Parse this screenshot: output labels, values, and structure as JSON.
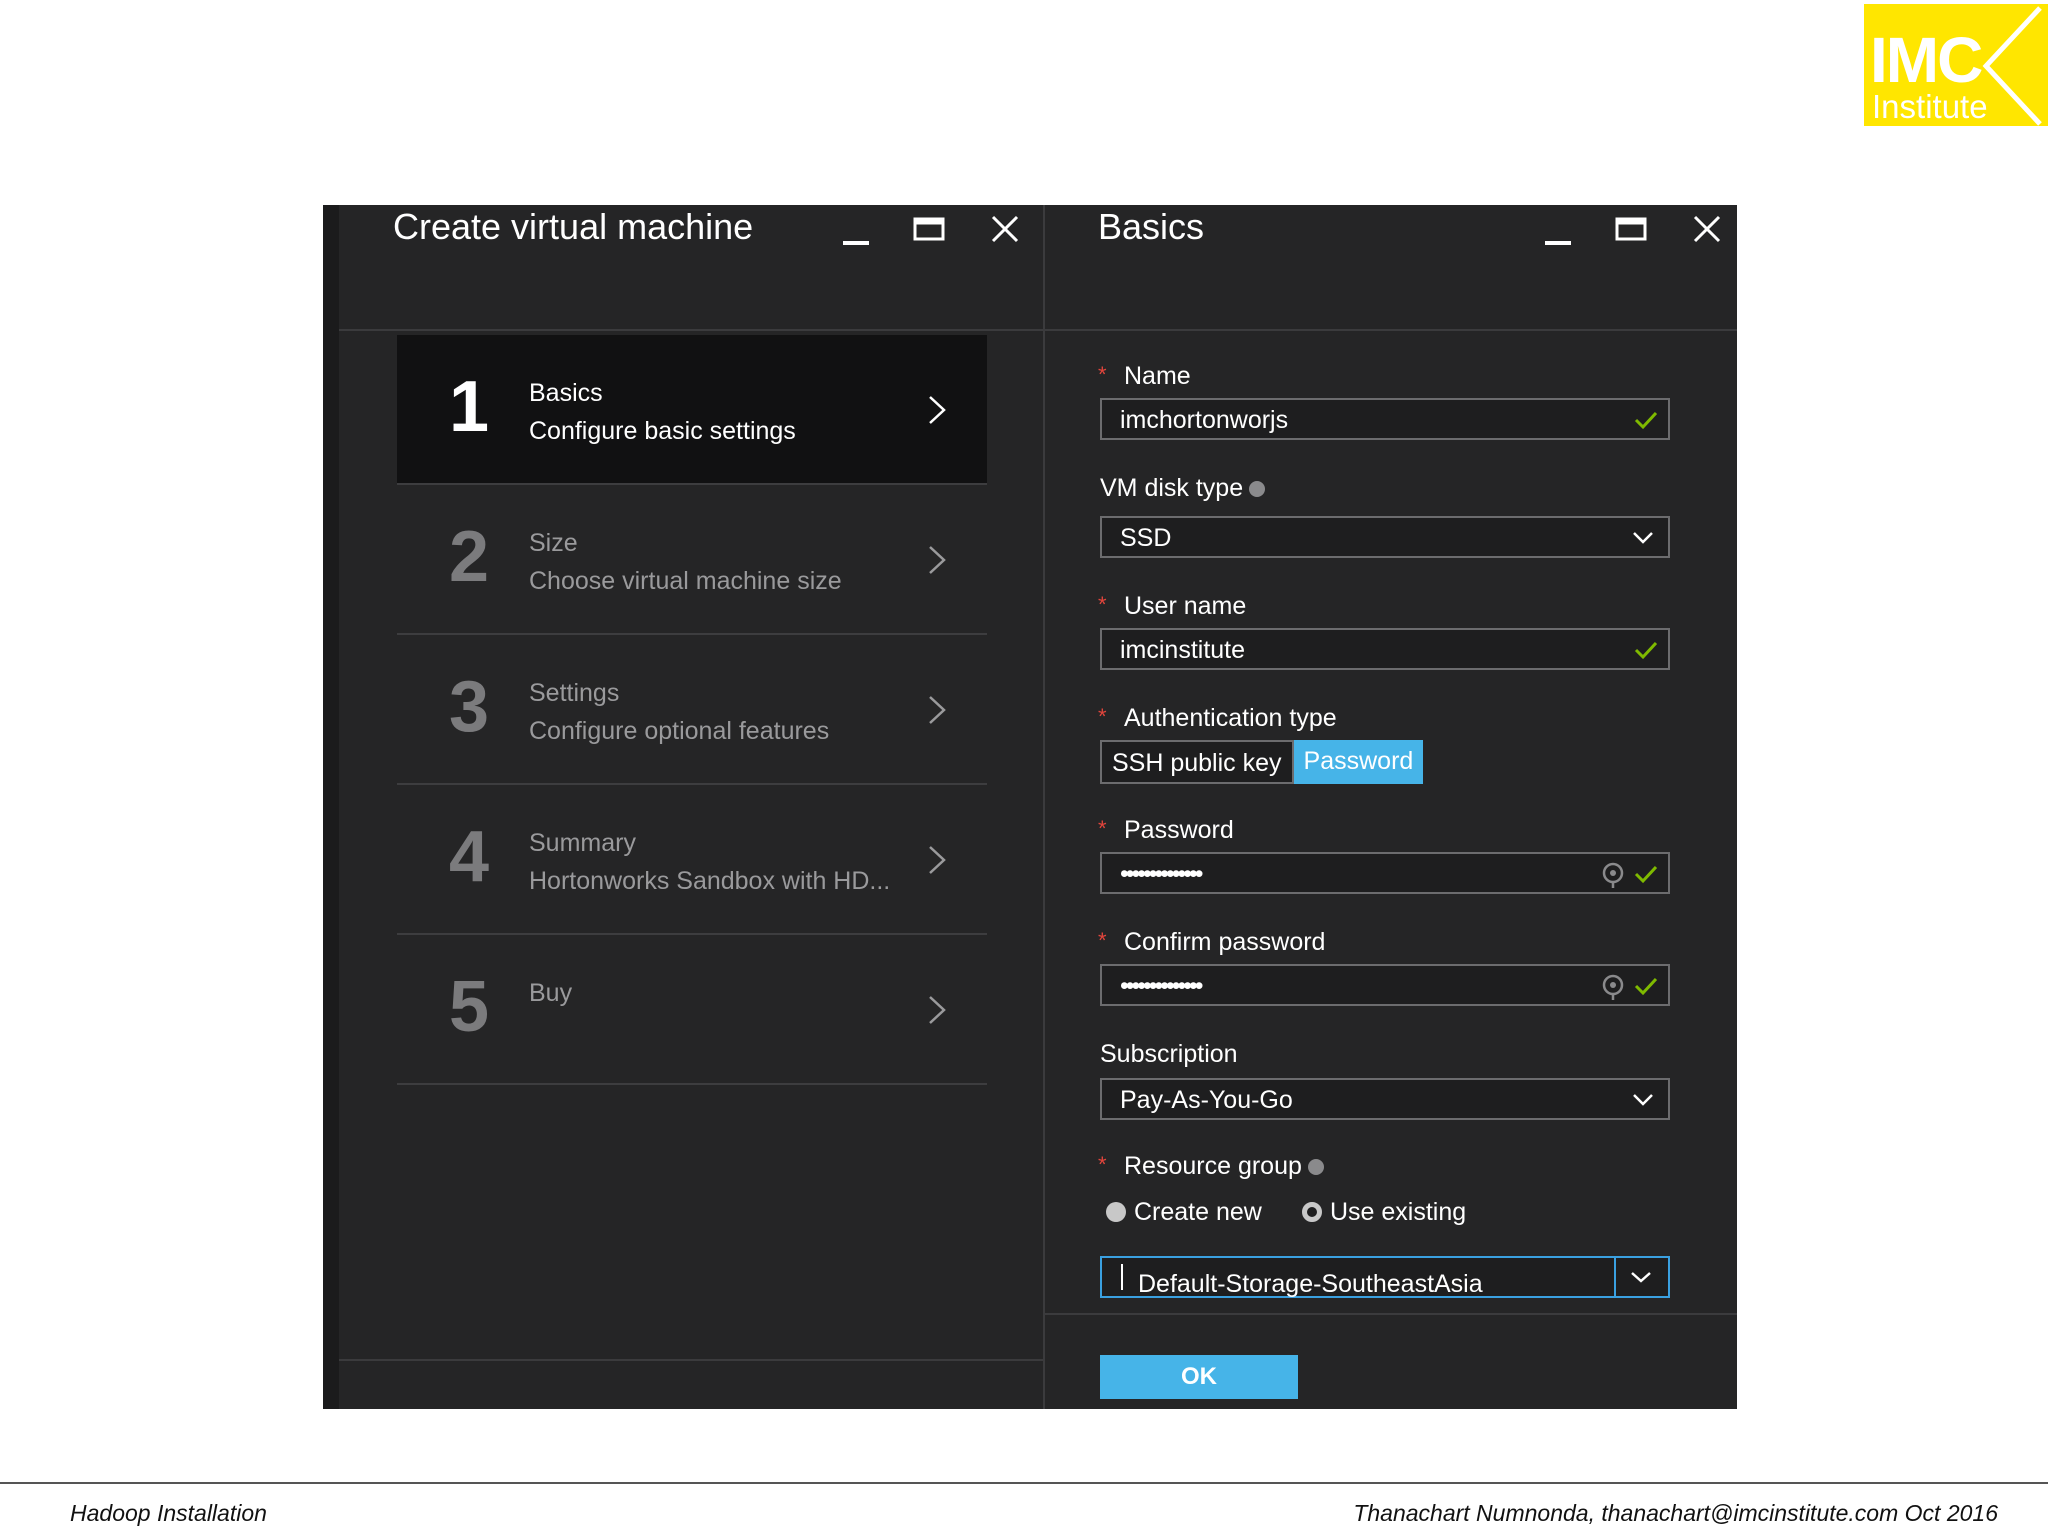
{
  "logo": {
    "line1": "IMC",
    "line2": "Institute"
  },
  "left_blade": {
    "title": "Create virtual machine",
    "steps": [
      {
        "num": "1",
        "title": "Basics",
        "desc": "Configure basic settings",
        "active": true
      },
      {
        "num": "2",
        "title": "Size",
        "desc": "Choose virtual machine size"
      },
      {
        "num": "3",
        "title": "Settings",
        "desc": "Configure optional features"
      },
      {
        "num": "4",
        "title": "Summary",
        "desc": "Hortonworks Sandbox with HD..."
      },
      {
        "num": "5",
        "title": "Buy",
        "desc": ""
      }
    ]
  },
  "right_blade": {
    "title": "Basics",
    "name": {
      "label": "Name",
      "value": "imchortonworjs"
    },
    "vm_disk_type": {
      "label": "VM disk type",
      "value": "SSD"
    },
    "user_name": {
      "label": "User name",
      "value": "imcinstitute"
    },
    "auth_type": {
      "label": "Authentication type",
      "options": [
        "SSH public key",
        "Password"
      ],
      "selected": "Password"
    },
    "password": {
      "label": "Password",
      "value": "••••••••••••••"
    },
    "confirm_password": {
      "label": "Confirm password",
      "value": "••••••••••••••"
    },
    "subscription": {
      "label": "Subscription",
      "value": "Pay-As-You-Go"
    },
    "resource_group": {
      "label": "Resource group",
      "create_new": "Create new",
      "use_existing": "Use existing",
      "selected": "Use existing",
      "value": "Default-Storage-SoutheastAsia"
    },
    "ok_label": "OK",
    "required_mark": "*"
  },
  "footer": {
    "left": "Hadoop Installation",
    "right": "Thanachart Numnonda,  thanachart@imcinstitute.com  Oct 2016"
  },
  "colors": {
    "accent": "#46b4e8",
    "panel": "#252526",
    "check": "#7fba00",
    "required": "#e2453c",
    "logo_bg": "#ffe600"
  }
}
